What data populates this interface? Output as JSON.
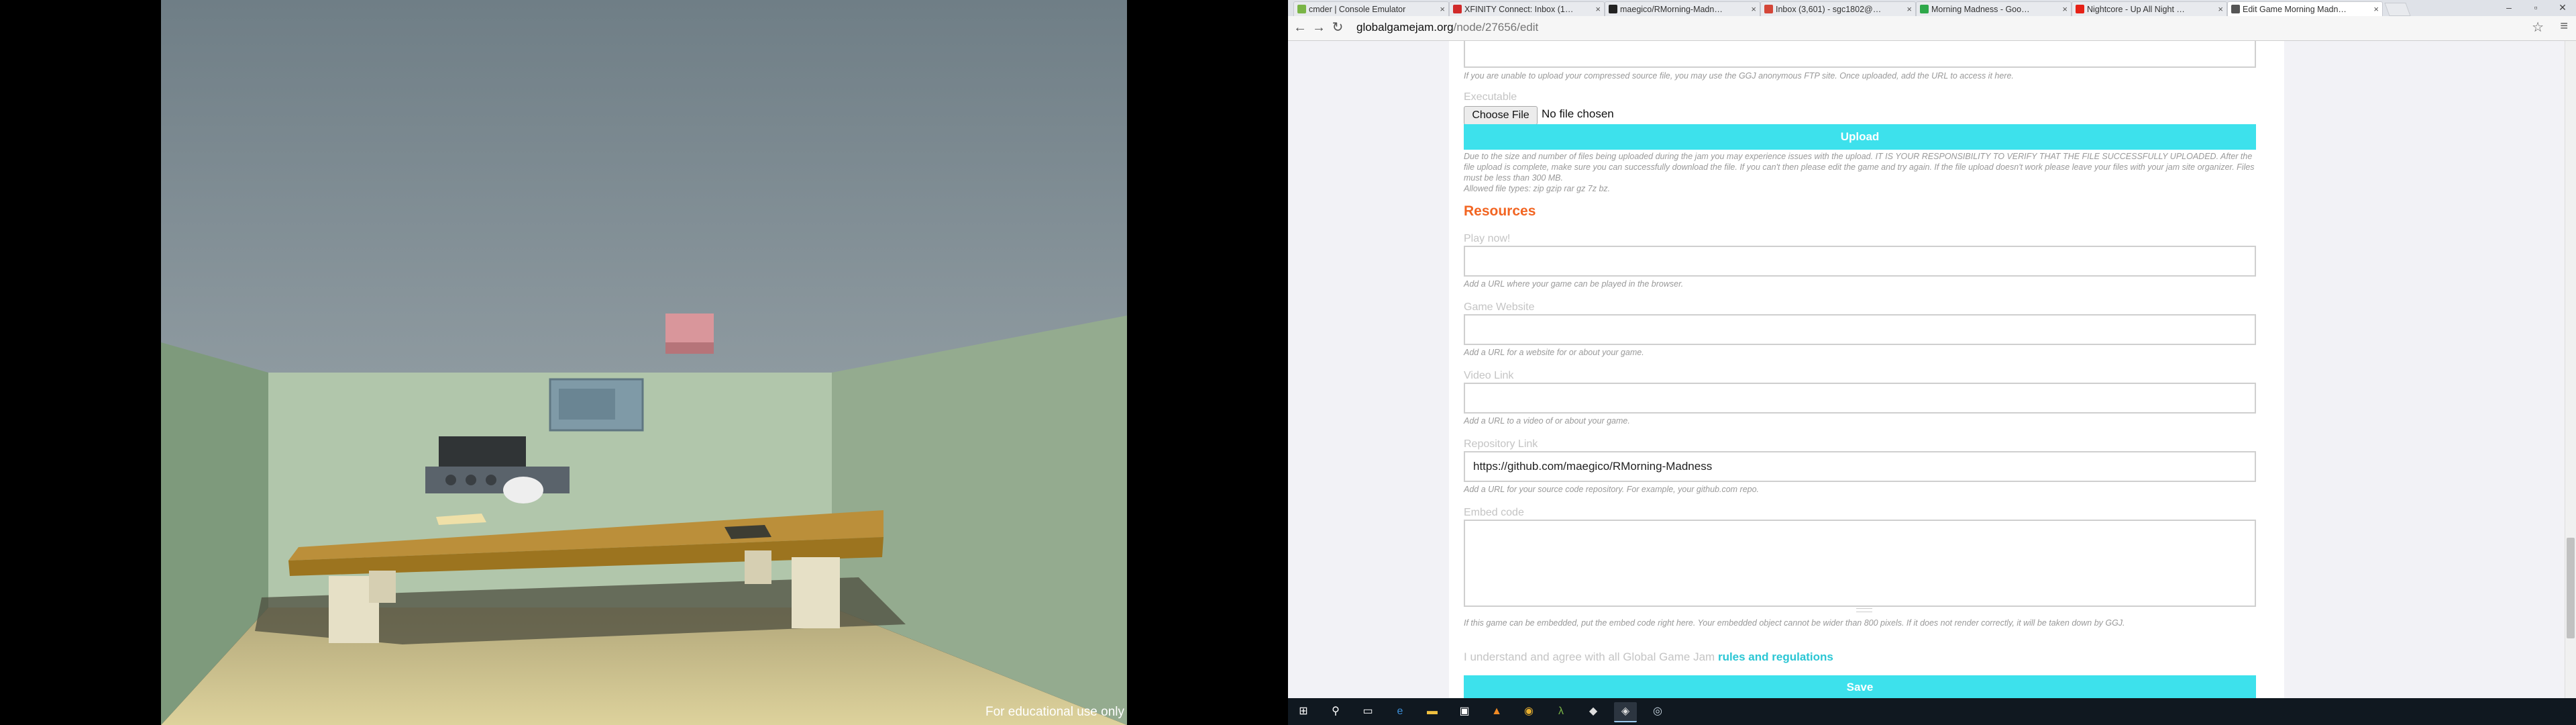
{
  "game": {
    "watermark": "For educational use only"
  },
  "browser": {
    "tabs": [
      {
        "label": "cmder | Console Emulator",
        "icon": "cmder-icon",
        "color": "#7ab547"
      },
      {
        "label": "XFINITY Connect: Inbox (1…",
        "icon": "xfinity-icon",
        "color": "#d12a2a"
      },
      {
        "label": "maegico/RMorning-Madn…",
        "icon": "github-icon",
        "color": "#222222"
      },
      {
        "label": "Inbox (3,601) - sgc1802@…",
        "icon": "gmail-icon",
        "color": "#d44638"
      },
      {
        "label": "Morning Madness - Goo…",
        "icon": "google-drive-icon",
        "color": "#2ea84a"
      },
      {
        "label": "Nightcore - Up All Night …",
        "icon": "youtube-icon",
        "color": "#e62117"
      },
      {
        "label": "Edit Game Morning Madn…",
        "icon": "ggj-icon",
        "color": "#555555"
      }
    ],
    "active_tab": 6,
    "url_host": "globalgamejam.org",
    "url_path": "/node/27656/edit"
  },
  "form": {
    "source_help": "If you are unable to upload your compressed source file, you may use the GGJ anonymous FTP site. Once uploaded, add the URL to access it here.",
    "executable_label": "Executable",
    "choose_file_label": "Choose File",
    "no_file_label": "No file chosen",
    "upload_label": "Upload",
    "upload_notice": "Due to the size and number of files being uploaded during the jam you may experience issues with the upload. IT IS YOUR RESPONSIBILITY TO VERIFY THAT THE FILE SUCCESSFULLY UPLOADED. After the file upload is complete, make sure you can successfully download the file. If you can't then please edit the game and try again. If the file upload doesn't work please leave your files with your jam site organizer. Files must be less than 300 MB.",
    "allowed_types": "Allowed file types: zip gzip rar gz 7z bz.",
    "resources_heading": "Resources",
    "play_now_label": "Play now!",
    "play_now_help": "Add a URL where your game can be played in the browser.",
    "website_label": "Game Website",
    "website_help": "Add a URL for a website for or about your game.",
    "video_label": "Video Link",
    "video_help": "Add a URL to a video of or about your game.",
    "repo_label": "Repository Link",
    "repo_value": "https://github.com/maegico/RMorning-Madness",
    "repo_help": "Add a URL for your source code repository. For example, your github.com repo.",
    "embed_label": "Embed code",
    "embed_help": "If this game can be embedded, put the embed code right here. Your embedded object cannot be wider than 800 pixels. If it does not render correctly, it will be taken down by GGJ.",
    "agree_text": "I understand and agree with all Global Game Jam",
    "agree_link": "rules and regulations",
    "save_label": "Save"
  },
  "taskbar": {
    "items": [
      {
        "icon": "windows-start-icon",
        "glyph": "⊞",
        "color": "#ffffff"
      },
      {
        "icon": "search-icon",
        "glyph": "⚲",
        "color": "#ffffff"
      },
      {
        "icon": "task-view-icon",
        "glyph": "▭",
        "color": "#ffffff"
      },
      {
        "icon": "edge-icon",
        "glyph": "e",
        "color": "#3c8fd8"
      },
      {
        "icon": "file-explorer-icon",
        "glyph": "▬",
        "color": "#f0c040"
      },
      {
        "icon": "store-icon",
        "glyph": "▣",
        "color": "#ffffff"
      },
      {
        "icon": "vlc-icon",
        "glyph": "▲",
        "color": "#f08a24"
      },
      {
        "icon": "chrome-icon",
        "glyph": "◉",
        "color": "#e8b030"
      },
      {
        "icon": "cmder-icon",
        "glyph": "λ",
        "color": "#7ab547"
      },
      {
        "icon": "unity-icon",
        "glyph": "◆",
        "color": "#dddddd"
      },
      {
        "icon": "unity-game-icon",
        "glyph": "◈",
        "color": "#dddddd"
      },
      {
        "icon": "steam-icon",
        "glyph": "◎",
        "color": "#c6d4df"
      }
    ],
    "active_index": 10
  }
}
